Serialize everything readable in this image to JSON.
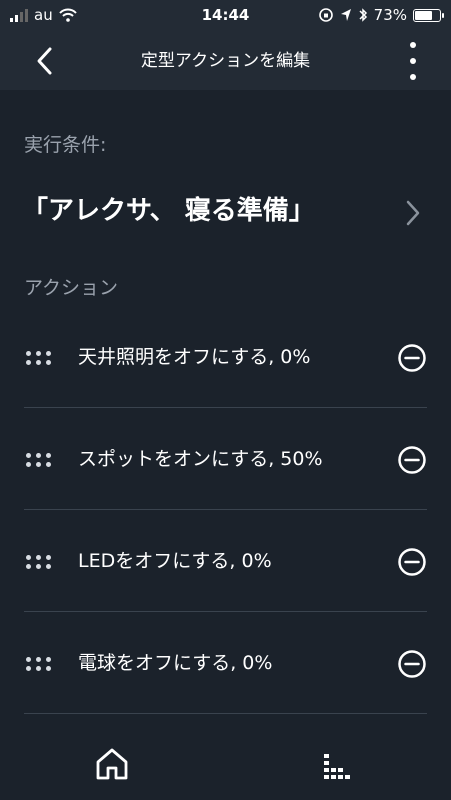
{
  "status_bar": {
    "carrier": "au",
    "time": "14:44",
    "battery_text": "73%",
    "battery_level": 0.73
  },
  "header": {
    "title": "定型アクションを編集"
  },
  "trigger": {
    "section_label": "実行条件:",
    "phrase": "「アレクサ、 寝る準備」"
  },
  "actions": {
    "section_label": "アクション",
    "items": [
      {
        "label": "天井照明をオフにする, 0%"
      },
      {
        "label": "スポットをオンにする, 50%"
      },
      {
        "label": "LEDをオフにする, 0%"
      },
      {
        "label": "電球をオフにする, 0%"
      }
    ]
  },
  "icons": {
    "back": "chevron-left-icon",
    "more": "more-vertical-icon",
    "forward": "chevron-right-icon",
    "drag": "drag-handle-icon",
    "remove": "minus-circle-icon",
    "home": "home-icon",
    "activity": "activity-icon"
  },
  "colors": {
    "background": "#1b222b",
    "header_background": "#232b35",
    "muted_text": "#9aa2ad",
    "divider": "#3a434e"
  }
}
